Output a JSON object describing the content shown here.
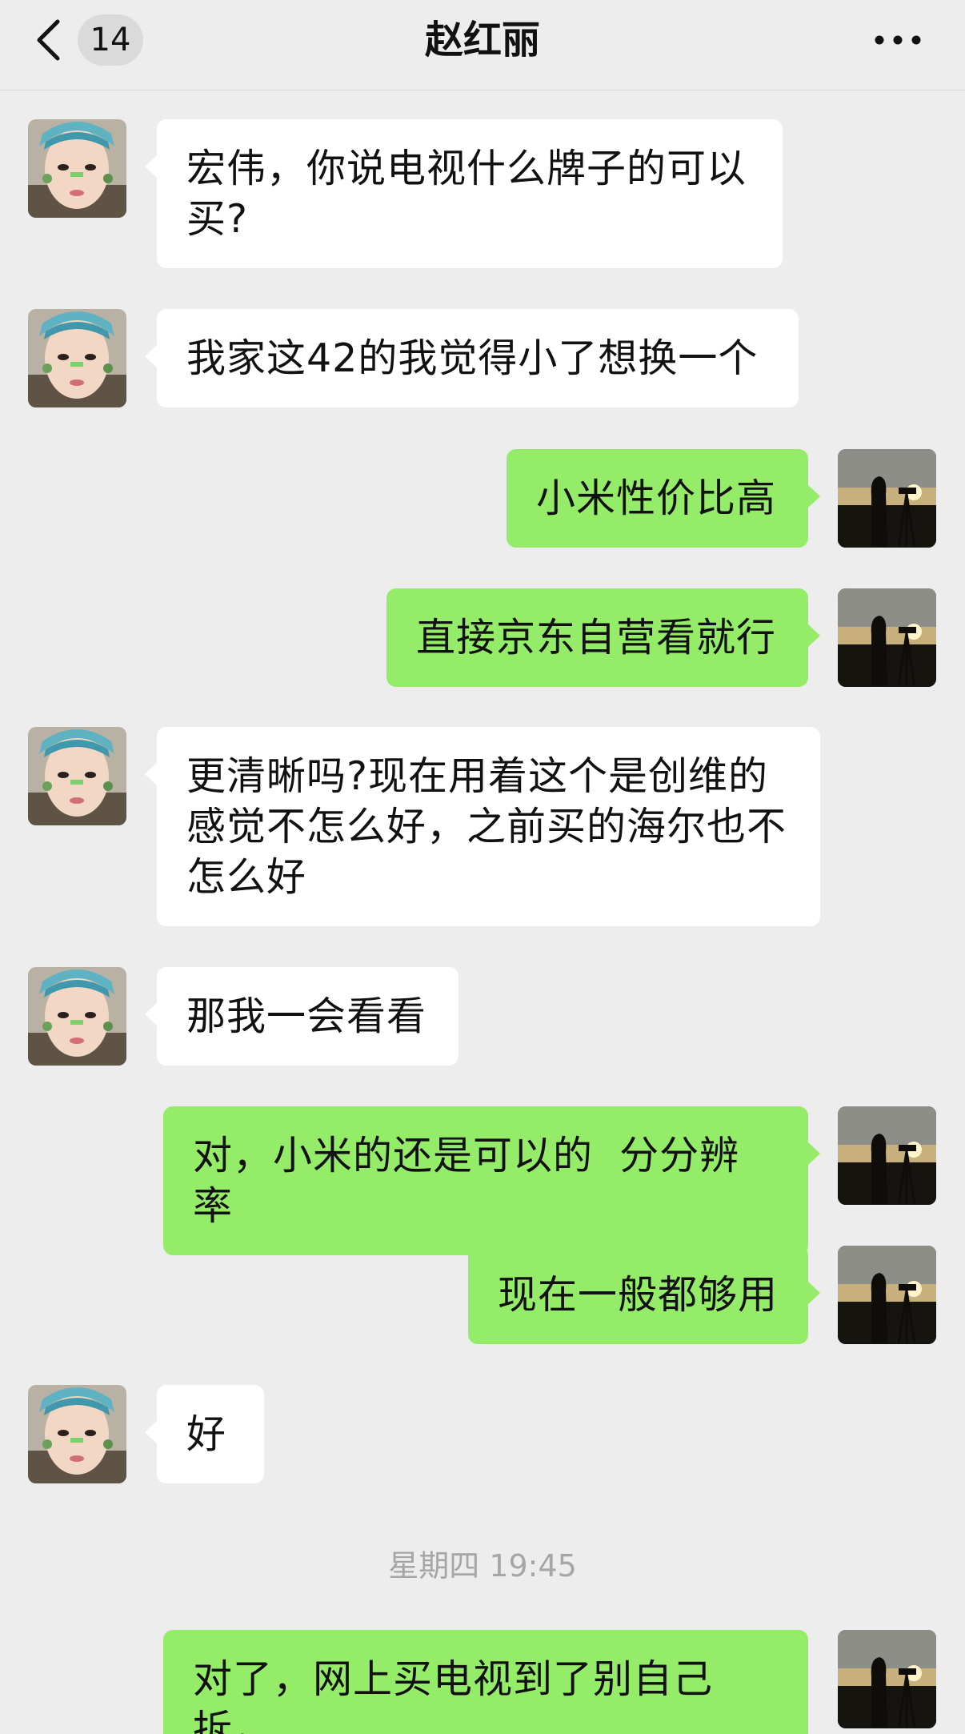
{
  "header": {
    "unread_count": "14",
    "title": "赵红丽"
  },
  "icons": {
    "back": "chevron-left-icon",
    "more": "more-dots-icon"
  },
  "messages": [
    {
      "from": "contact",
      "text": "宏伟，你说电视什么牌子的可以\n买?"
    },
    {
      "from": "contact",
      "text": "我家这42的我觉得小了想换一个"
    },
    {
      "from": "me",
      "text": "小米性价比高"
    },
    {
      "from": "me",
      "text": "直接京东自营看就行"
    },
    {
      "from": "contact",
      "text": "更清晰吗?现在用着这个是创维的\n感觉不怎么好，之前买的海尔也不\n怎么好"
    },
    {
      "from": "contact",
      "text": "那我一会看看"
    },
    {
      "from": "me",
      "text": "对，小米的还是可以的  分分辨率"
    },
    {
      "from": "me",
      "text": "现在一般都够用"
    },
    {
      "from": "contact",
      "text": "好"
    },
    {
      "from": "me",
      "text": "对了，网上买电视到了别自己拆，\n让预约上门的人拆，切记"
    }
  ],
  "time_divider": "星期四 19:45",
  "colors": {
    "background": "#ededed",
    "outgoing_bubble": "#95ec69",
    "incoming_bubble": "#ffffff",
    "timestamp": "#a6a6a6"
  }
}
